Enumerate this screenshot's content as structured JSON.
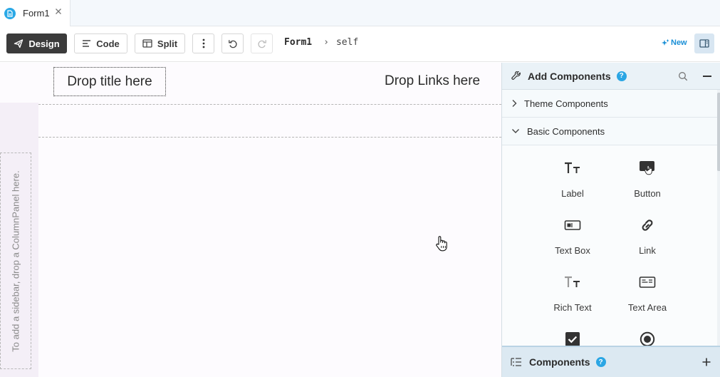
{
  "tabs": [
    {
      "label": "Form1",
      "icon": "form-file-icon"
    }
  ],
  "toolbar": {
    "design_label": "Design",
    "code_label": "Code",
    "split_label": "Split",
    "breadcrumb_root": "Form1",
    "breadcrumb_separator": "›",
    "breadcrumb_current": "self",
    "new_label": "New"
  },
  "canvas": {
    "title_placeholder": "Drop title here",
    "links_placeholder": "Drop Links here",
    "sidebar_hint": "To add a sidebar, drop a ColumnPanel here."
  },
  "panel": {
    "title": "Add Components",
    "help": "?",
    "sections": [
      {
        "label": "Theme Components",
        "expanded": false
      },
      {
        "label": "Basic Components",
        "expanded": true
      }
    ],
    "components": [
      {
        "label": "Label",
        "icon": "label-icon"
      },
      {
        "label": "Button",
        "icon": "button-icon"
      },
      {
        "label": "Text Box",
        "icon": "textbox-icon"
      },
      {
        "label": "Link",
        "icon": "link-icon"
      },
      {
        "label": "Rich Text",
        "icon": "rich-text-icon"
      },
      {
        "label": "Text Area",
        "icon": "text-area-icon"
      },
      {
        "label": "",
        "icon": "checkbox-icon"
      },
      {
        "label": "",
        "icon": "radio-button-icon"
      }
    ],
    "footer_title": "Components"
  },
  "colors": {
    "accent": "#29a8e6",
    "design_button": "#3b3b3b",
    "panel_header": "#eaf2f7",
    "panel_footer": "#dce9f2",
    "canvas_bg": "#fdfbfe"
  }
}
